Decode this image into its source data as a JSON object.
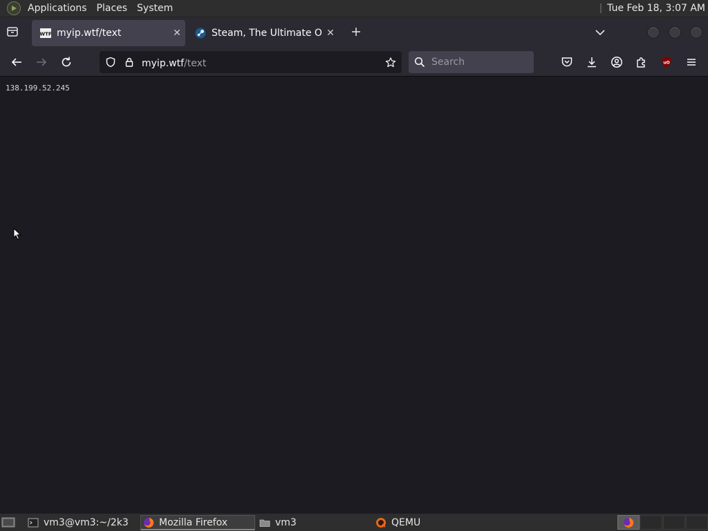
{
  "top_panel": {
    "menus": [
      "Applications",
      "Places",
      "System"
    ],
    "clock": "Tue Feb 18,  3:07 AM"
  },
  "browser": {
    "tabs": [
      {
        "title": "myip.wtf/text",
        "favicon": "wtf-favicon",
        "active": true
      },
      {
        "title": "Steam, The Ultimate Online",
        "favicon": "steam-favicon",
        "active": false
      }
    ],
    "url": {
      "host": "myip.wtf",
      "path": "/text"
    },
    "search_placeholder": "Search"
  },
  "page": {
    "ip_address": "138.199.52.245"
  },
  "taskbar": {
    "items": [
      {
        "label": "vm3@vm3:~/2k3",
        "icon": "terminal-icon"
      },
      {
        "label": "Mozilla Firefox",
        "icon": "firefox-icon",
        "active": true
      },
      {
        "label": "vm3",
        "icon": "folder-icon"
      },
      {
        "label": "QEMU",
        "icon": "qemu-icon"
      }
    ]
  },
  "colors": {
    "page_bg": "#1c1b22",
    "chrome_bg": "#2b2a33",
    "active_tab": "#42414d",
    "panel_bg": "#2e2e2e",
    "ublock_red": "#800000"
  }
}
